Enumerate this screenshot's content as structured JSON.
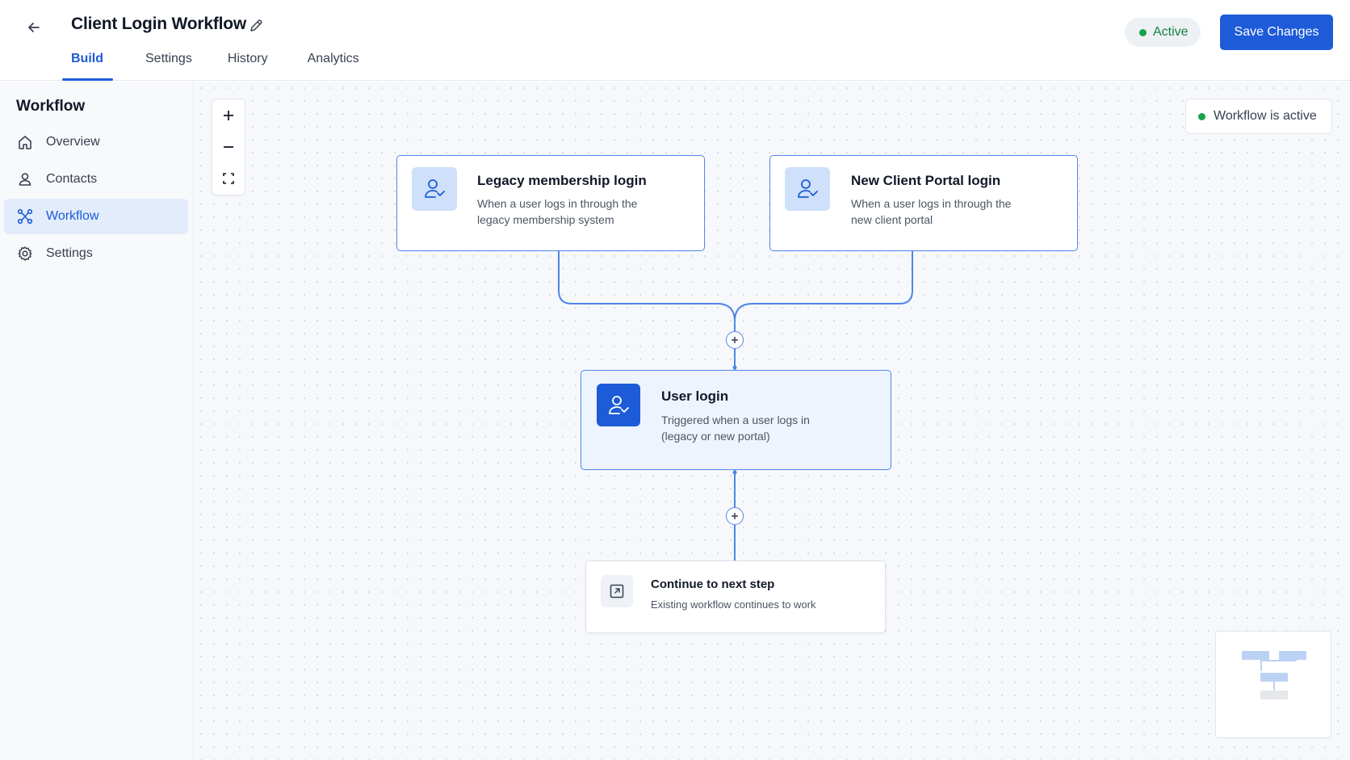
{
  "header": {
    "title": "Client Login Workflow",
    "tabs": [
      {
        "label": "Build",
        "active": true
      },
      {
        "label": "Settings",
        "active": false
      },
      {
        "label": "History",
        "active": false
      },
      {
        "label": "Analytics",
        "active": false
      }
    ],
    "status_label": "Active",
    "save_label": "Save Changes"
  },
  "sidebar": {
    "title": "Workflow",
    "items": [
      {
        "label": "Overview",
        "icon": "home-icon",
        "active": false
      },
      {
        "label": "Contacts",
        "icon": "user-icon",
        "active": false
      },
      {
        "label": "Workflow",
        "icon": "workflow-icon",
        "active": true
      },
      {
        "label": "Settings",
        "icon": "gear-icon",
        "active": false
      }
    ]
  },
  "canvas": {
    "status_badge": "Workflow is active",
    "zoom_controls": [
      "zoom-in-icon",
      "zoom-out-icon",
      "fit-view-icon"
    ],
    "nodes": {
      "legacy": {
        "title": "Legacy membership login",
        "desc_line1": "When a user logs in through the",
        "desc_line2": "legacy membership system",
        "icon": "user-login-icon"
      },
      "portal": {
        "title": "New Client Portal login",
        "desc_line1": "When a user logs in through the",
        "desc_line2": "new client portal",
        "icon": "user-login-icon"
      },
      "trigger": {
        "title": "User login",
        "desc_line1": "Triggered when a user logs in",
        "desc_line2": "(legacy or new portal)",
        "icon": "user-login-icon"
      },
      "next": {
        "title": "Continue to next step",
        "desc": "Existing workflow continues to work",
        "icon": "external-step-icon"
      }
    }
  },
  "colors": {
    "accent": "#1d5bd8",
    "connector": "#4f86e8",
    "status_green": "#16a34a",
    "trigger_icon_bg": "#cfe0fb",
    "main_node_bg": "#eef4fd"
  }
}
